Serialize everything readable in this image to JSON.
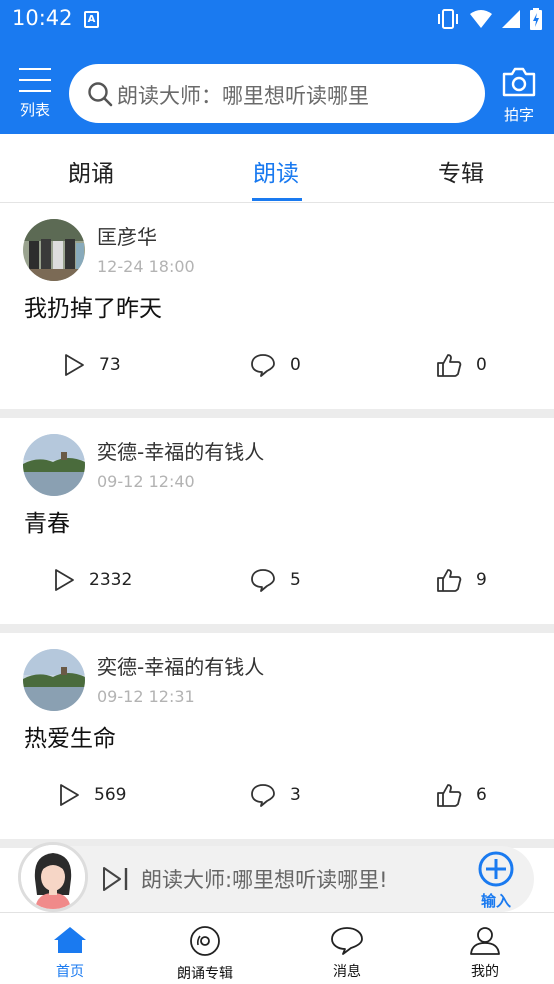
{
  "status_bar": {
    "time": "10:42",
    "app_badge": "A"
  },
  "header": {
    "menu_label": "列表",
    "search_placeholder": "朗读大师：哪里想听读哪里",
    "camera_label": "拍字",
    "brand_color": "#1a7af0"
  },
  "tabs": [
    {
      "label": "朗诵",
      "active": false
    },
    {
      "label": "朗读",
      "active": true
    },
    {
      "label": "专辑",
      "active": false
    }
  ],
  "posts": [
    {
      "author": "匡彦华",
      "time": "12-24 18:00",
      "title": "我扔掉了昨天",
      "plays": "73",
      "comments": "0",
      "likes": "0"
    },
    {
      "author": "奕德-幸福的有钱人",
      "time": "09-12 12:40",
      "title": "青春",
      "plays": "2332",
      "comments": "5",
      "likes": "9"
    },
    {
      "author": "奕德-幸福的有钱人",
      "time": "09-12 12:31",
      "title": "热爱生命",
      "plays": "569",
      "comments": "3",
      "likes": "6"
    }
  ],
  "player": {
    "text": "朗读大师:哪里想听读哪里!",
    "add_label": "输入"
  },
  "bottom_nav": [
    {
      "label": "首页",
      "icon": "home-icon",
      "active": true
    },
    {
      "label": "朗诵专辑",
      "icon": "disc-icon",
      "active": false
    },
    {
      "label": "消息",
      "icon": "message-icon",
      "active": false
    },
    {
      "label": "我的",
      "icon": "user-icon",
      "active": false
    }
  ]
}
